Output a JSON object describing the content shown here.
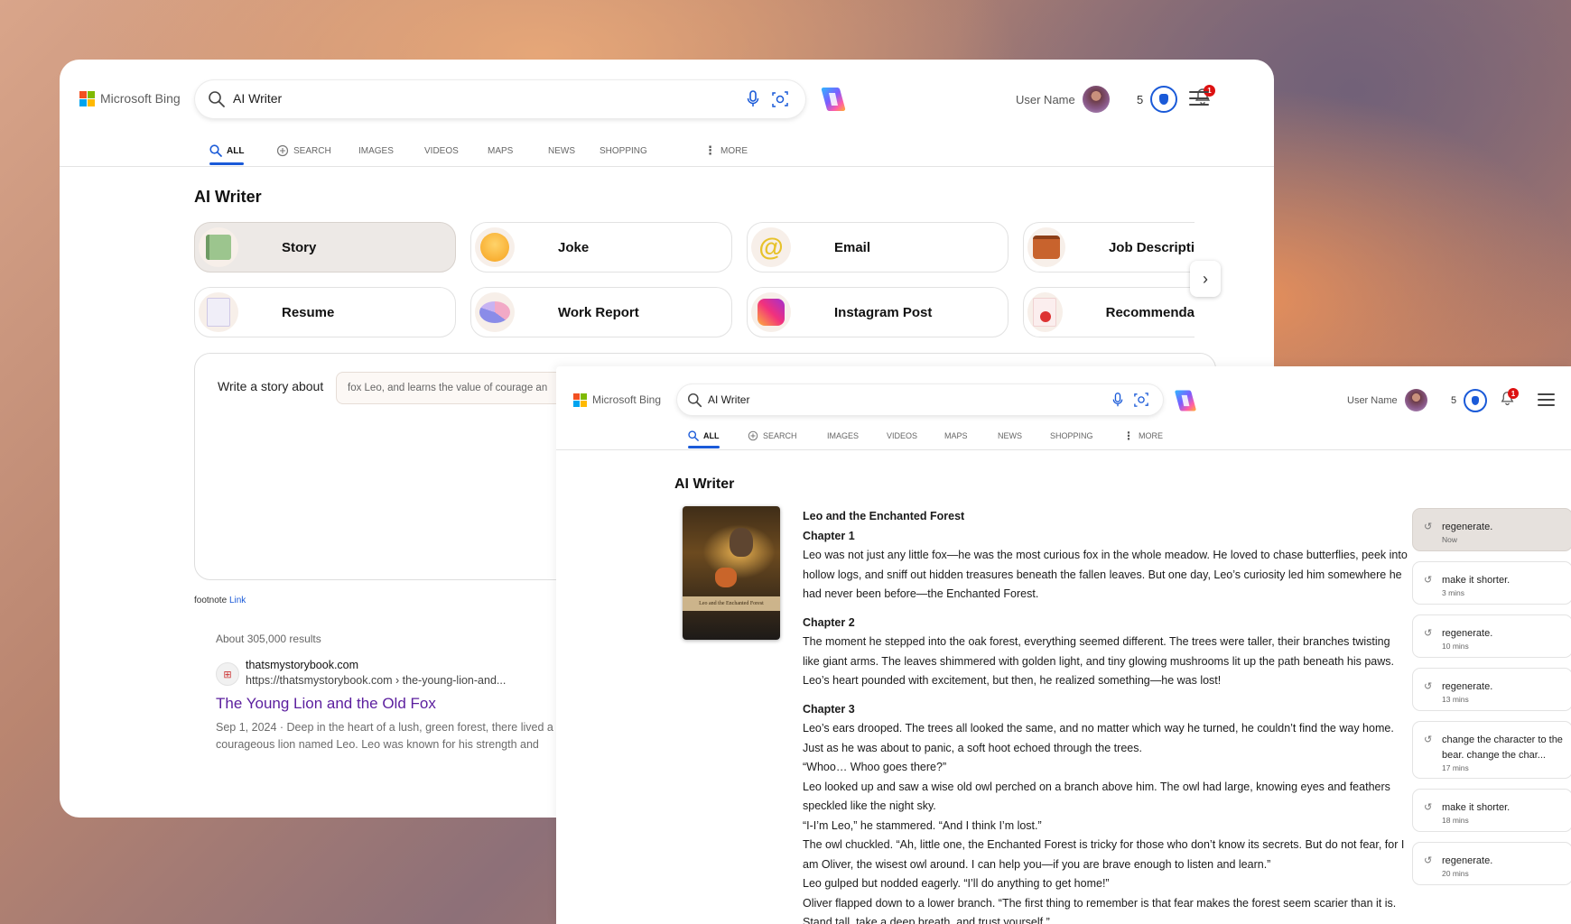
{
  "brand": "Microsoft Bing",
  "search": {
    "query": "AI Writer"
  },
  "user": {
    "name": "User Name",
    "points": "5",
    "notifications": "1"
  },
  "tabs": [
    {
      "label": "ALL",
      "icon": "search-icon"
    },
    {
      "label": "SEARCH",
      "icon": "copilot-chat-icon"
    },
    {
      "label": "IMAGES"
    },
    {
      "label": "VIDEOS"
    },
    {
      "label": "MAPS"
    },
    {
      "label": "NEWS"
    },
    {
      "label": "SHOPPING"
    },
    {
      "label": "MORE",
      "icon": "more-vertical-icon"
    }
  ],
  "page_title": "AI Writer",
  "categories": [
    {
      "label": "Story",
      "icon": "book-icon"
    },
    {
      "label": "Joke",
      "icon": "laughing-face-icon"
    },
    {
      "label": "Email",
      "icon": "at-sign-icon"
    },
    {
      "label": "Job Descripti",
      "icon": "briefcase-icon"
    },
    {
      "label": "Resume",
      "icon": "resume-icon"
    },
    {
      "label": "Work Report",
      "icon": "pie-chart-icon"
    },
    {
      "label": "Instagram Post",
      "icon": "instagram-icon"
    },
    {
      "label": "Recommenda",
      "icon": "certificate-icon"
    }
  ],
  "prompt": {
    "lead": "Write a story about",
    "value": "fox Leo, and learns the value of courage an"
  },
  "footnote": {
    "text": "footnote",
    "link": "Link"
  },
  "results": {
    "count": "About 305,000 results",
    "items": [
      {
        "site": "thatsmystorybook.com",
        "url": "https://thatsmystorybook.com › the-young-lion-and...",
        "title": "The Young Lion and the Old Fox",
        "snippet": "Sep 1, 2024 · Deep in the heart of a lush, green forest, there lived a young and courageous lion named Leo. Leo was known for his strength and"
      }
    ]
  },
  "story": {
    "cover_title": "Leo and the Enchanted Forest",
    "title": "Leo and the Enchanted Forest",
    "chapter1_heading": "Chapter 1",
    "chapter1_text": "Leo was not just any little fox—he was the most curious fox in the whole meadow. He loved to chase butterflies, peek into hollow logs, and sniff out hidden treasures beneath the fallen leaves. But one day, Leo’s curiosity led him somewhere he had never been before—the Enchanted Forest.",
    "chapter2_heading": "Chapter 2",
    "chapter2_text": "The moment he stepped into the oak forest, everything seemed different. The trees were taller, their branches twisting like giant arms. The leaves shimmered with golden light, and tiny glowing mushrooms lit up the path beneath his paws. Leo’s heart pounded with excitement, but then, he realized something—he was lost!",
    "chapter3_heading": "Chapter 3",
    "chapter3_lines": [
      "Leo’s ears drooped. The trees all looked the same, and no matter which way he turned, he couldn’t find the way home. Just as he was about to panic, a soft hoot echoed through the trees.",
      "“Whoo… Whoo goes there?”",
      " Leo looked up and saw a wise old owl perched on a branch above him. The owl had large, knowing eyes and feathers speckled like the night sky.",
      "“I-I’m Leo,” he stammered. “And I think I’m lost.”",
      "The owl chuckled. “Ah, little one, the Enchanted Forest is tricky for those who don’t know its secrets. But do not fear, for I am Oliver, the wisest owl around. I can help you—if you are brave enough to listen and learn.”",
      "Leo gulped but nodded eagerly. “I’ll do anything to get home!”",
      "Oliver flapped down to a lower branch. “The first thing to remember is that fear makes the forest seem scarier than it is. Stand tall, take a deep breath, and trust yourself.”"
    ]
  },
  "history": [
    {
      "text": "regenerate.",
      "time": "Now"
    },
    {
      "text": "make it shorter.",
      "time": "3 mins"
    },
    {
      "text": "regenerate.",
      "time": "10 mins"
    },
    {
      "text": "regenerate.",
      "time": "13 mins"
    },
    {
      "text": "change the character to the bear. change the char...",
      "time": "17 mins"
    },
    {
      "text": "make it shorter.",
      "time": "18 mins"
    },
    {
      "text": "regenerate.",
      "time": "20 mins"
    }
  ]
}
